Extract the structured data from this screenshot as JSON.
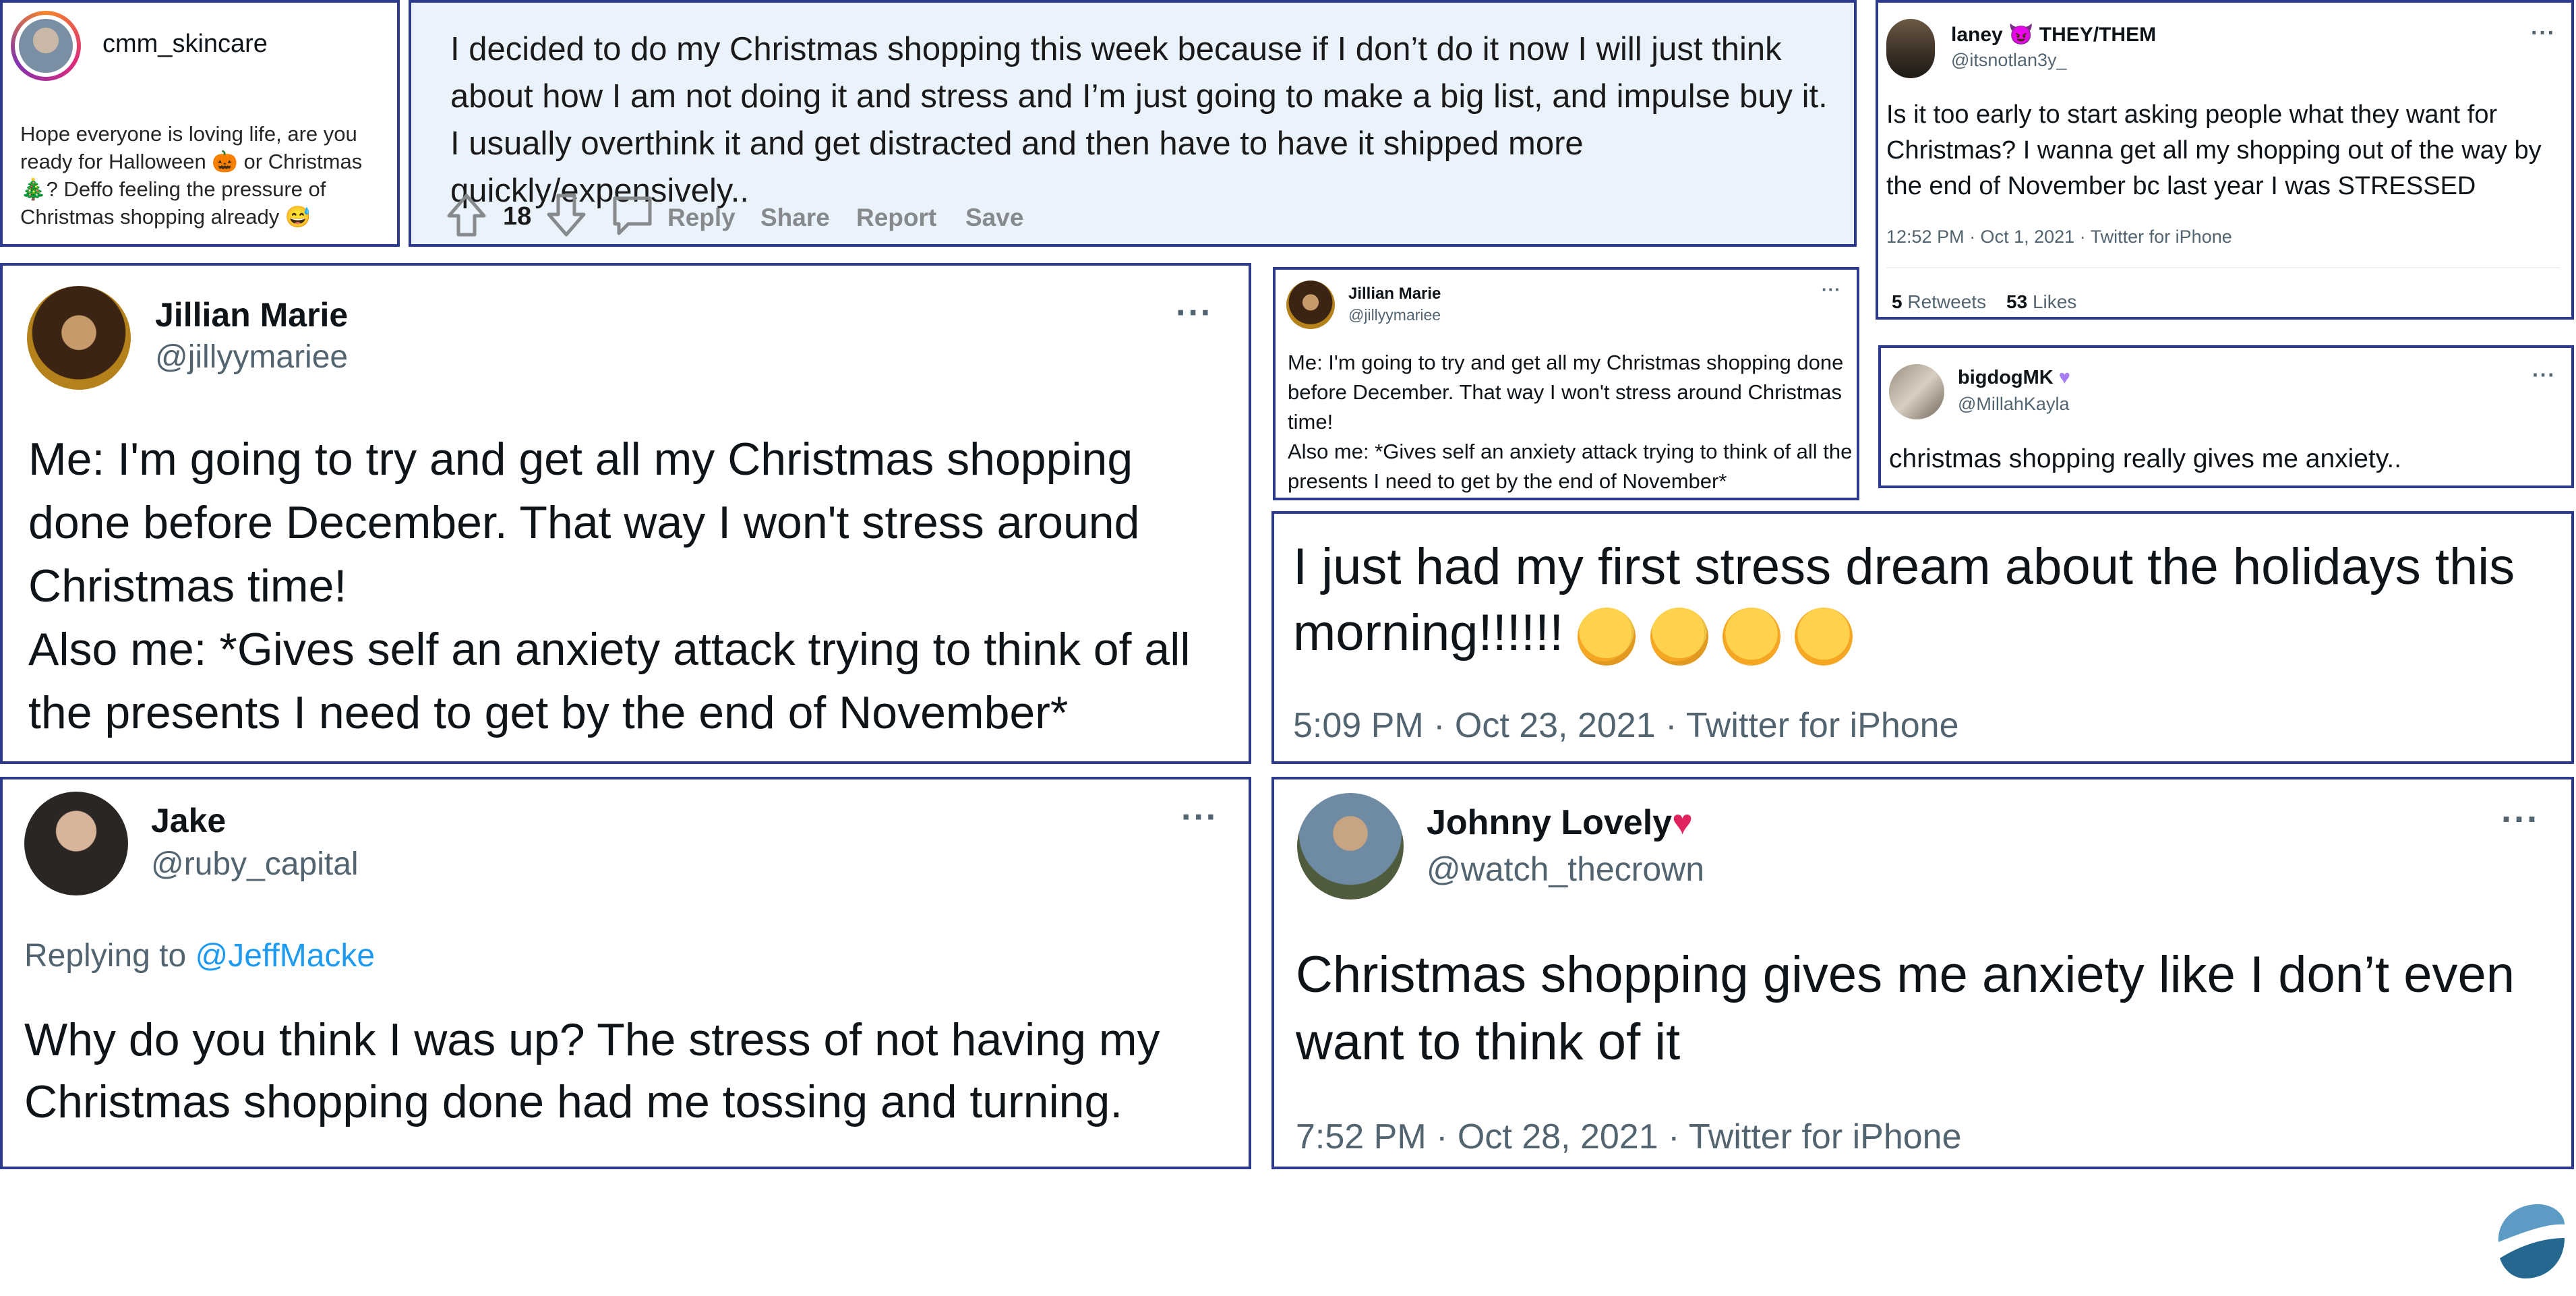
{
  "ig": {
    "username": "cmm_skincare",
    "caption": "Hope everyone is loving life, are you ready for Halloween 🎃 or Christmas 🎄? Deffo feeling the pressure of Christmas shopping already 😅"
  },
  "reddit": {
    "text": "I decided to do my Christmas shopping this week because if I don’t do it now I will just think about how I am not doing it and stress and I’m just going to make a big list, and impulse buy it. I usually overthink it and get distracted and then have to have it shipped more quickly/expensively..",
    "score": "18",
    "actions": [
      "Reply",
      "Share",
      "Report",
      "Save"
    ]
  },
  "laney": {
    "name": "laney 😈 THEY/THEM",
    "handle": "@itsnotlan3y_",
    "text": "Is it too early to start asking people what they want for Christmas? I wanna get all my shopping out of the way by the end of November bc last year I was STRESSED",
    "meta": "12:52 PM · Oct 1, 2021 · Twitter for iPhone",
    "retweets": "5",
    "retweets_label": "Retweets",
    "likes": "53",
    "likes_label": "Likes"
  },
  "jillian_large": {
    "name": "Jillian Marie",
    "handle": "@jillyymariee",
    "text": "Me: I'm going to try and get all my Christmas shopping done before December. That way I won't stress around Christmas time!\nAlso me: *Gives self an anxiety attack trying to think of all the presents I need to get by the end of November*"
  },
  "jillian_small": {
    "name": "Jillian Marie",
    "handle": "@jillyymariee",
    "text": "Me: I'm going to try and get all my Christmas shopping done before December. That way I won't stress around Christmas time!\nAlso me: *Gives self an anxiety attack trying to think of all the presents I need to get by the end of November*"
  },
  "bigdog": {
    "name": "bigdogMK",
    "handle": "@MillahKayla",
    "text": "christmas shopping really gives me anxiety.."
  },
  "stress_dream": {
    "text": "I just had my first stress dream about the holidays this morning!!!!!!",
    "meta": "5:09 PM · Oct 23, 2021 · Twitter for iPhone"
  },
  "jake": {
    "name": "Jake",
    "handle": "@ruby_capital",
    "replying_prefix": "Replying to",
    "replying_to": "@JeffMacke",
    "text": "Why do you think I was up? The stress of not having my Christmas shopping done had me tossing and turning."
  },
  "johnny": {
    "name": "Johnny Lovely",
    "handle": "@watch_thecrown",
    "text": "Christmas shopping gives me anxiety like I don’t even want to think of it",
    "meta": "7:52 PM · Oct 28, 2021 · Twitter for iPhone"
  },
  "more_label": "···",
  "colors": {
    "border": "#2d3a8c",
    "link": "#1d9bf0",
    "muted": "#536471",
    "reddit_bg": "#eaf3fb",
    "logo_light": "#5b9bc4",
    "logo_dark": "#24688f"
  }
}
